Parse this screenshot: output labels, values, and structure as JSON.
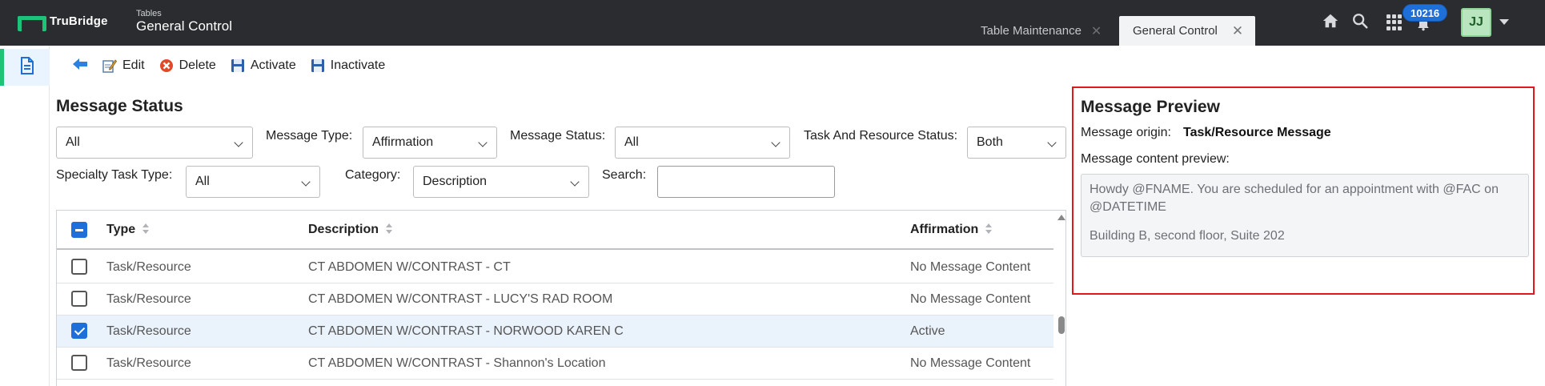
{
  "header": {
    "logo_text": "TruBridge",
    "app_subtitle": "Tables",
    "app_title": "General Control",
    "tabs": [
      {
        "label": "Table Maintenance",
        "active": false
      },
      {
        "label": "General Control",
        "active": true
      }
    ],
    "notification_count": "10216",
    "avatar_initials": "JJ",
    "icons": [
      "home-icon",
      "search-icon",
      "apps-grid-icon",
      "bell-icon",
      "chevron-down-icon"
    ]
  },
  "sidebar": {
    "items": [
      {
        "icon": "document-icon",
        "active": true
      }
    ]
  },
  "toolbar": {
    "back_icon": "back-arrow-icon",
    "edit_label": "Edit",
    "delete_label": "Delete",
    "activate_label": "Activate",
    "inactivate_label": "Inactivate"
  },
  "message_status": {
    "title": "Message Status",
    "filters": {
      "first_select": "All",
      "message_type_label": "Message Type:",
      "message_type_value": "Affirmation",
      "message_status_label": "Message Status:",
      "message_status_value": "All",
      "task_resource_status_label": "Task And Resource Status:",
      "task_resource_status_value": "Both",
      "specialty_task_type_label": "Specialty Task Type:",
      "specialty_task_type_value": "All",
      "category_label": "Category:",
      "category_value": "Description",
      "search_label": "Search:",
      "search_value": ""
    },
    "table": {
      "columns": [
        "Type",
        "Description",
        "Affirmation"
      ],
      "rows": [
        {
          "type": "Task/Resource",
          "description": "CT ABDOMEN W/CONTRAST - CT",
          "affirmation": "No Message Content",
          "checked": false
        },
        {
          "type": "Task/Resource",
          "description": "CT ABDOMEN W/CONTRAST - LUCY'S RAD ROOM",
          "affirmation": "No Message Content",
          "checked": false
        },
        {
          "type": "Task/Resource",
          "description": "CT ABDOMEN W/CONTRAST - NORWOOD KAREN C",
          "affirmation": "Active",
          "checked": true
        },
        {
          "type": "Task/Resource",
          "description": "CT ABDOMEN W/CONTRAST - Shannon's Location",
          "affirmation": "No Message Content",
          "checked": false
        }
      ]
    }
  },
  "preview": {
    "title": "Message Preview",
    "origin_label": "Message origin:",
    "origin_value": "Task/Resource Message",
    "content_label": "Message content preview:",
    "content_line1": "Howdy @FNAME. You are scheduled for an appointment with @FAC on",
    "content_line2": "@DATETIME",
    "content_line3": "Building B, second floor, Suite 202"
  },
  "colors": {
    "topbar": "#2a2c2f",
    "brand_green": "#1ec37a",
    "accent_blue": "#1e6fd9",
    "highlight_red": "#e0191a"
  }
}
